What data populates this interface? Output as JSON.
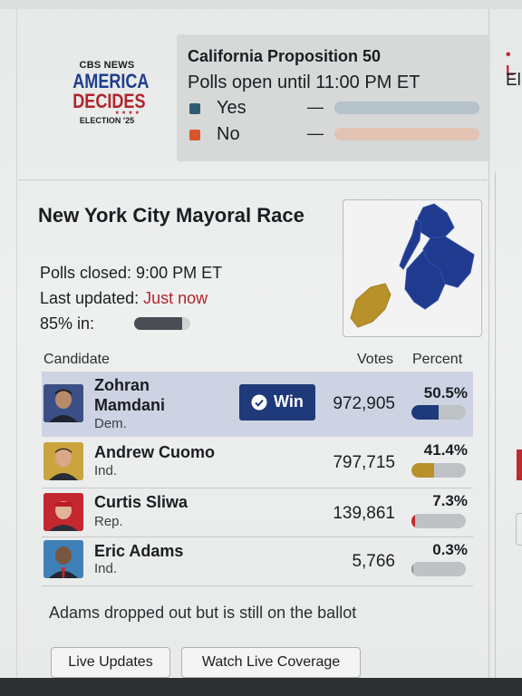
{
  "header": {
    "logo": {
      "network": "CBS NEWS",
      "line1": "AMERICA",
      "line2": "DECIDES",
      "stars": "★★★★",
      "sub": "ELECTION '25"
    },
    "proposition": {
      "title": "California Proposition 50",
      "status": "Polls open until 11:00 PM ET",
      "options": [
        {
          "label": "Yes",
          "value": "—",
          "color": "#2f5c73"
        },
        {
          "label": "No",
          "value": "—",
          "color": "#d8552a"
        }
      ]
    },
    "side_peek": {
      "line1": "• L",
      "line2": "El"
    }
  },
  "race": {
    "title": "New York City Mayoral Race",
    "polls_closed": "Polls closed: 9:00 PM ET",
    "last_updated_label": "Last updated:",
    "last_updated_value": "Just now",
    "reporting_label": "85% in:",
    "reporting_fraction": 0.85
  },
  "table": {
    "headers": {
      "candidate": "Candidate",
      "votes": "Votes",
      "percent": "Percent"
    },
    "win_label": "Win",
    "rows": [
      {
        "name_line1": "Zohran",
        "name_line2": "Mamdani",
        "party": "Dem.",
        "votes": "972,905",
        "percent": "50.5%",
        "pct_value": 0.505,
        "bar_color": "#1f3a7a",
        "winner": true
      },
      {
        "name_line1": "Andrew Cuomo",
        "name_line2": "",
        "party": "Ind.",
        "votes": "797,715",
        "percent": "41.4%",
        "pct_value": 0.414,
        "bar_color": "#b8912a",
        "winner": false
      },
      {
        "name_line1": "Curtis Sliwa",
        "name_line2": "",
        "party": "Rep.",
        "votes": "139,861",
        "percent": "7.3%",
        "pct_value": 0.073,
        "bar_color": "#c3282f",
        "winner": false
      },
      {
        "name_line1": "Eric Adams",
        "name_line2": "",
        "party": "Ind.",
        "votes": "5,766",
        "percent": "0.3%",
        "pct_value": 0.003,
        "bar_color": "#8a8d90",
        "winner": false
      }
    ]
  },
  "footer": {
    "note": "Adams dropped out but is still on the ballot",
    "buttons": [
      "Live Updates",
      "Watch Live Coverage"
    ]
  },
  "colors": {
    "dem_blue": "#1f3a7a",
    "ind_gold": "#b8912a",
    "rep_red": "#c3282f",
    "link_red": "#b3242d"
  }
}
